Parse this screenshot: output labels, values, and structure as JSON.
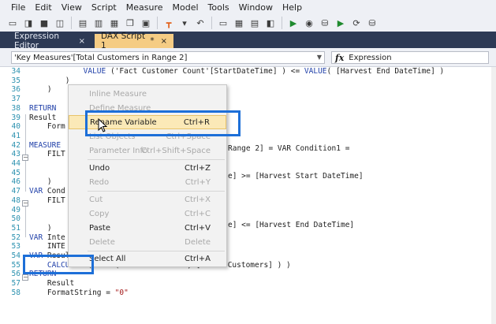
{
  "menubar": {
    "items": [
      "File",
      "Edit",
      "View",
      "Script",
      "Measure",
      "Model",
      "Tools",
      "Window",
      "Help"
    ]
  },
  "toolbar": {
    "icons": [
      "open-icon",
      "new-icon",
      "save-icon",
      "save-all-icon",
      "script-icon",
      "document-icon",
      "table-icon",
      "copy-icon",
      "paste-icon",
      "relationship-icon",
      "undo-icon",
      "run-icon",
      "camera-icon",
      "database-icon",
      "run-icon",
      "refresh-icon",
      "database-icon",
      "window-icon"
    ]
  },
  "tabs": [
    {
      "label": "Expression Editor",
      "close": "×",
      "active": false
    },
    {
      "label": "DAX Script 1",
      "close": "×",
      "modified": "*",
      "active": true
    }
  ],
  "expression_bar": {
    "object_value": "'Key Measures'[Total Customers in Range 2]",
    "fx_label": "Expression"
  },
  "code_lines": [
    {
      "n": "34",
      "text": "            VALUE ('Fact Customer Count'[StartDateTime] ) <= VALUE( [Harvest End DateTime] )"
    },
    {
      "n": "35",
      "text": "        )"
    },
    {
      "n": "36",
      "text": "    )"
    },
    {
      "n": "37",
      "text": ""
    },
    {
      "n": "38",
      "text": "RETURN"
    },
    {
      "n": "39",
      "text": "Result"
    },
    {
      "n": "40",
      "text": "    Form"
    },
    {
      "n": "41",
      "text": ""
    },
    {
      "n": "42",
      "text": "MEASURE"
    },
    {
      "n": "43",
      "text": "    FILT"
    },
    {
      "n": "44",
      "text": ""
    },
    {
      "n": "45",
      "text": ""
    },
    {
      "n": "46",
      "text": "    )"
    },
    {
      "n": "47",
      "text": "VAR Cond"
    },
    {
      "n": "48",
      "text": "    FILT"
    },
    {
      "n": "49",
      "text": ""
    },
    {
      "n": "50",
      "text": ""
    },
    {
      "n": "51",
      "text": "    )"
    },
    {
      "n": "52",
      "text": "VAR Inte"
    },
    {
      "n": "53",
      "text": "    INTE"
    },
    {
      "n": "54",
      "text": "VAR Result ="
    },
    {
      "n": "55",
      "text": "    CALCULATE( SUMX( Intersect1and2, [Total Customers] ) )"
    },
    {
      "n": "56",
      "text": "RETURN"
    },
    {
      "n": "57",
      "text": "    Result"
    },
    {
      "n": "58",
      "text": "    FormatString = \"0\""
    }
  ],
  "code_fragments": {
    "line42_tail": "Range 2] = VAR Condition1 =",
    "line45_tail": "e] >= [Harvest Start DateTime]",
    "line50_tail": "e] <= [Harvest End DateTime]"
  },
  "context_menu": {
    "items": [
      {
        "label": "Inline Measure",
        "shortcut": "",
        "enabled": false
      },
      {
        "label": "Define Measure",
        "shortcut": "",
        "enabled": false
      },
      {
        "label": "Rename Variable",
        "shortcut": "Ctrl+R",
        "enabled": true,
        "highlighted": true
      },
      {
        "label": "List Objects",
        "shortcut": "Ctrl+Space",
        "enabled": false
      },
      {
        "label": "Parameter Info",
        "shortcut": "Ctrl+Shift+Space",
        "enabled": false
      },
      {
        "label": "Undo",
        "shortcut": "Ctrl+Z",
        "enabled": true
      },
      {
        "label": "Redo",
        "shortcut": "Ctrl+Y",
        "enabled": false
      },
      {
        "label": "Cut",
        "shortcut": "Ctrl+X",
        "enabled": false
      },
      {
        "label": "Copy",
        "shortcut": "Ctrl+C",
        "enabled": false
      },
      {
        "label": "Paste",
        "shortcut": "Ctrl+V",
        "enabled": true
      },
      {
        "label": "Delete",
        "shortcut": "Delete",
        "enabled": false
      },
      {
        "label": "Select All",
        "shortcut": "Ctrl+A",
        "enabled": true
      }
    ]
  },
  "colors": {
    "tab_active_bg": "#f5cc84",
    "tab_strip_bg": "#2d3a55",
    "highlight_box": "#1d6fd8",
    "menu_highlight": "#fbe9b7",
    "keyword": "#1f3fa8",
    "string": "#a31515",
    "variable": "#c23d3d",
    "line_number": "#2b91af"
  }
}
